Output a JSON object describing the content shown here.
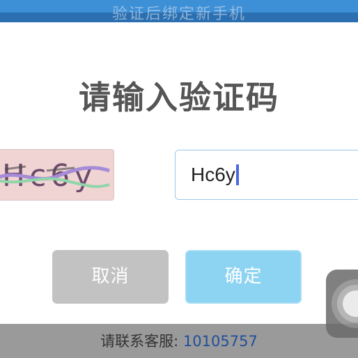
{
  "topbar": {
    "title": "验证后绑定新手机"
  },
  "dialog": {
    "title": "请输入验证码",
    "captcha": {
      "text": "Hc6y"
    },
    "input": {
      "value": "Hc6y"
    },
    "cancel_label": "取消",
    "confirm_label": "确定"
  },
  "footer": {
    "contact_label": "请联系客服: ",
    "contact_number": "10105757"
  },
  "colors": {
    "topbar": "#2b6fb0",
    "cancel_button": "#c2c2c2",
    "confirm_button": "#8dd3f2",
    "input_border": "#9cc8ea",
    "caret": "#4a67e0",
    "bottombar": "#9a9a9a",
    "contact_number": "#1f4f9a"
  },
  "icons": {
    "assist": "assistive-touch-icon"
  }
}
